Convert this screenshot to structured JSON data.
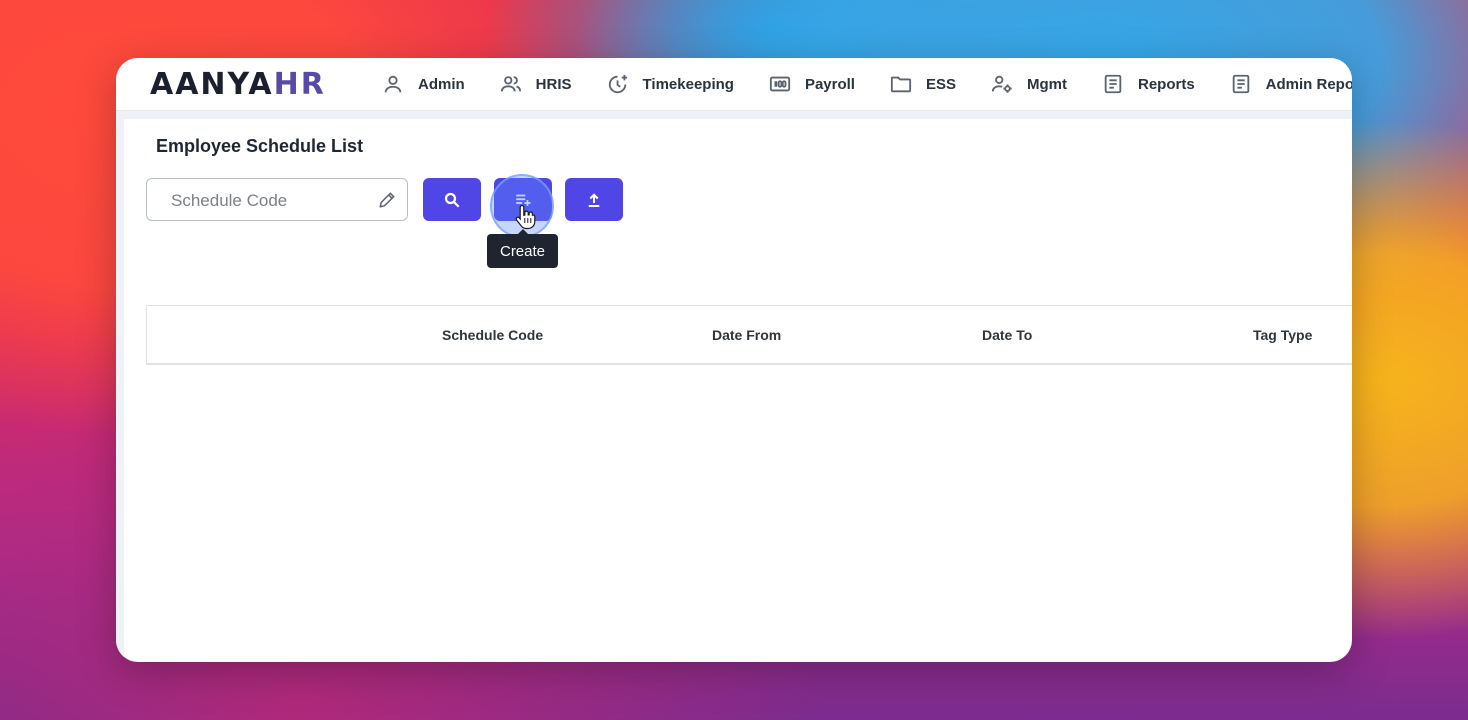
{
  "app": {
    "logo_main": "AANYA",
    "logo_accent": "HR"
  },
  "nav": {
    "items": [
      {
        "label": "Admin",
        "icon": "user-icon"
      },
      {
        "label": "HRIS",
        "icon": "users-icon"
      },
      {
        "label": "Timekeeping",
        "icon": "clock-plus-icon"
      },
      {
        "label": "Payroll",
        "icon": "payroll-icon"
      },
      {
        "label": "ESS",
        "icon": "folder-icon"
      },
      {
        "label": "Mgmt",
        "icon": "user-gear-icon"
      },
      {
        "label": "Reports",
        "icon": "document-icon"
      },
      {
        "label": "Admin Repor",
        "icon": "document-icon"
      }
    ]
  },
  "page": {
    "title": "Employee Schedule List"
  },
  "search": {
    "placeholder": "Schedule Code",
    "value": ""
  },
  "toolbar": {
    "search_button": "search-icon",
    "create_button": "playlist-add-icon",
    "upload_button": "upload-icon",
    "tooltip": "Create"
  },
  "table": {
    "columns": [
      "Schedule Code",
      "Date From",
      "Date To",
      "Tag Type"
    ],
    "rows": []
  },
  "colors": {
    "accent": "#4f46e5",
    "logo_accent": "#5a4aa8",
    "tooltip_bg": "#1f2430"
  }
}
